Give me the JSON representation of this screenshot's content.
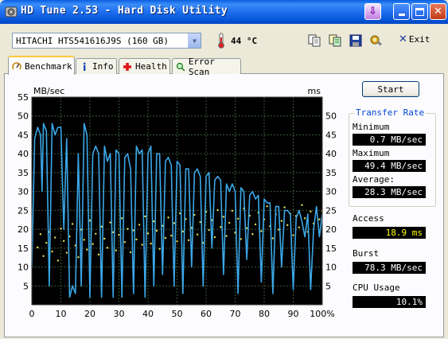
{
  "window": {
    "title": "HD Tune 2.53 - Hard Disk Utility"
  },
  "toolbar": {
    "drive": "HITACHI HTS541616J9S (160 GB)",
    "temperature": "44 °C",
    "exit_label": "Exit",
    "icons": [
      "copy-icon",
      "copy-text-icon",
      "save-icon",
      "options-icon"
    ]
  },
  "tabs": [
    {
      "label": "Benchmark",
      "icon": "benchmark-icon",
      "active": true
    },
    {
      "label": "Info",
      "icon": "info-icon",
      "active": false
    },
    {
      "label": "Health",
      "icon": "health-icon",
      "active": false
    },
    {
      "label": "Error Scan",
      "icon": "magnifier-icon",
      "active": false
    }
  ],
  "controls": {
    "start_label": "Start"
  },
  "transfer_rate": {
    "title": "Transfer Rate",
    "minimum_label": "Minimum",
    "minimum_value": "0.7 MB/sec",
    "maximum_label": "Maximum",
    "maximum_value": "49.4 MB/sec",
    "average_label": "Average:",
    "average_value": "28.3 MB/sec"
  },
  "access": {
    "label": "Access",
    "value": "18.9 ms"
  },
  "burst": {
    "label": "Burst",
    "value": "78.3 MB/sec"
  },
  "cpu": {
    "label": "CPU Usage",
    "value": "10.1%"
  },
  "colors": {
    "transfer_line": "#3BA7E8",
    "access_dots": "#E8E050",
    "chart_bg": "#000000",
    "grid": "#3A5A3A"
  },
  "chart_data": {
    "type": "line",
    "xlabel": "",
    "ylabel_left": "MB/sec",
    "ylabel_right": "ms",
    "x_ticks": [
      "0",
      "10",
      "20",
      "30",
      "40",
      "50",
      "60",
      "70",
      "80",
      "90",
      "100%"
    ],
    "y_left_ticks": [
      "5",
      "10",
      "15",
      "20",
      "25",
      "30",
      "35",
      "40",
      "45",
      "50",
      "55"
    ],
    "y_right_ticks": [
      "5",
      "10",
      "15",
      "20",
      "25",
      "30",
      "35",
      "40",
      "45",
      "50"
    ],
    "xlim": [
      0,
      100
    ],
    "ylim_left": [
      0,
      55
    ],
    "ylim_right": [
      0,
      55
    ],
    "grid": true,
    "series": [
      {
        "kind": "transfer",
        "x": [
          0,
          1,
          2,
          3,
          3.5,
          4,
          5,
          6,
          7,
          8,
          9,
          10,
          11,
          12,
          13,
          14,
          15,
          16,
          17,
          18,
          19,
          20,
          21,
          22,
          23,
          24,
          25,
          26,
          27,
          28,
          29,
          30,
          31,
          32,
          33,
          34,
          35,
          36,
          37,
          38,
          39,
          40,
          41,
          42,
          43,
          44,
          45,
          46,
          47,
          48,
          49,
          50,
          51,
          52,
          53,
          54,
          55,
          56,
          57,
          58,
          59,
          60,
          61,
          62,
          63,
          64,
          65,
          66,
          67,
          68,
          69,
          70,
          71,
          72,
          73,
          74,
          75,
          76,
          77,
          78,
          79,
          80,
          81,
          82,
          83,
          84,
          85,
          86,
          87,
          88,
          89,
          90,
          91,
          92,
          93,
          94,
          95,
          96,
          97,
          98,
          99,
          100
        ],
        "y": [
          10,
          44,
          47,
          45,
          30,
          48,
          46,
          5,
          48,
          45,
          47,
          47,
          20,
          44,
          2,
          5,
          3,
          40,
          5,
          48,
          45,
          2,
          40,
          42,
          40,
          2,
          42,
          38,
          40,
          2,
          41,
          40,
          2,
          39,
          40,
          36,
          3,
          42,
          40,
          41,
          2,
          40,
          42,
          5,
          40,
          40,
          8,
          38,
          39,
          37,
          5,
          38,
          37,
          3,
          36,
          36,
          10,
          35,
          36,
          34,
          5,
          34,
          35,
          15,
          33,
          34,
          33,
          8,
          32,
          30,
          32,
          30,
          3,
          31,
          30,
          12,
          29,
          30,
          28,
          29,
          6,
          28,
          27,
          27,
          3,
          26,
          26,
          10,
          25,
          25,
          24,
          4,
          23,
          25,
          22,
          18,
          24,
          4,
          20,
          26,
          18,
          24
        ]
      },
      {
        "kind": "access",
        "points": [
          [
            2,
            15.2
          ],
          [
            3,
            18.7
          ],
          [
            4,
            12.9
          ],
          [
            5,
            16.4
          ],
          [
            6,
            19.3
          ],
          [
            7,
            14.1
          ],
          [
            8,
            17.8
          ],
          [
            9,
            11.7
          ],
          [
            10,
            20.2
          ],
          [
            11,
            16.9
          ],
          [
            12,
            13.8
          ],
          [
            13,
            18.1
          ],
          [
            14,
            21.4
          ],
          [
            15,
            15.7
          ],
          [
            16,
            12.6
          ],
          [
            17,
            19.9
          ],
          [
            18,
            17.2
          ],
          [
            19,
            14.6
          ],
          [
            20,
            22.3
          ],
          [
            21,
            16.1
          ],
          [
            22,
            18.8
          ],
          [
            23,
            13.3
          ],
          [
            24,
            20.7
          ],
          [
            25,
            17.5
          ],
          [
            26,
            15.1
          ],
          [
            27,
            21.8
          ],
          [
            28,
            19.2
          ],
          [
            29,
            14.4
          ],
          [
            30,
            18.5
          ],
          [
            31,
            22.9
          ],
          [
            32,
            16.6
          ],
          [
            33,
            20.1
          ],
          [
            34,
            13.9
          ],
          [
            35,
            19.7
          ],
          [
            36,
            17.3
          ],
          [
            37,
            21.2
          ],
          [
            38,
            15.9
          ],
          [
            39,
            23.4
          ],
          [
            40,
            18.9
          ],
          [
            41,
            16.2
          ],
          [
            42,
            22.1
          ],
          [
            43,
            19.6
          ],
          [
            44,
            14.8
          ],
          [
            45,
            20.9
          ],
          [
            46,
            17.7
          ],
          [
            47,
            23.1
          ],
          [
            48,
            18.3
          ],
          [
            49,
            21.6
          ],
          [
            50,
            16.8
          ],
          [
            51,
            24.2
          ],
          [
            52,
            19.4
          ],
          [
            53,
            22.7
          ],
          [
            54,
            17.1
          ],
          [
            55,
            20.4
          ],
          [
            56,
            23.8
          ],
          [
            57,
            18.6
          ],
          [
            58,
            21.9
          ],
          [
            59,
            16.4
          ],
          [
            60,
            24.6
          ],
          [
            61,
            19.8
          ],
          [
            62,
            22.4
          ],
          [
            63,
            17.9
          ],
          [
            64,
            25.1
          ],
          [
            65,
            20.6
          ],
          [
            66,
            23.3
          ],
          [
            67,
            18.2
          ],
          [
            68,
            21.7
          ],
          [
            69,
            24.9
          ],
          [
            70,
            19.1
          ],
          [
            71,
            22.8
          ],
          [
            72,
            17.4
          ],
          [
            73,
            25.5
          ],
          [
            74,
            20.3
          ],
          [
            75,
            23.6
          ],
          [
            76,
            18.7
          ],
          [
            77,
            21.3
          ],
          [
            78,
            24.4
          ],
          [
            79,
            19.5
          ],
          [
            80,
            22.6
          ],
          [
            81,
            26.1
          ],
          [
            82,
            20.8
          ],
          [
            83,
            17.6
          ],
          [
            84,
            23.9
          ],
          [
            85,
            19.9
          ],
          [
            86,
            22.2
          ],
          [
            87,
            25.8
          ],
          [
            88,
            21.1
          ],
          [
            89,
            24.1
          ],
          [
            90,
            18.4
          ],
          [
            91,
            23.5
          ],
          [
            92,
            20.5
          ],
          [
            93,
            26.4
          ],
          [
            94,
            22.9
          ],
          [
            95,
            19.3
          ],
          [
            96,
            24.7
          ],
          [
            97,
            21.5
          ],
          [
            98,
            25.3
          ],
          [
            99,
            22.6
          ],
          [
            100,
            24.8
          ]
        ]
      }
    ]
  }
}
